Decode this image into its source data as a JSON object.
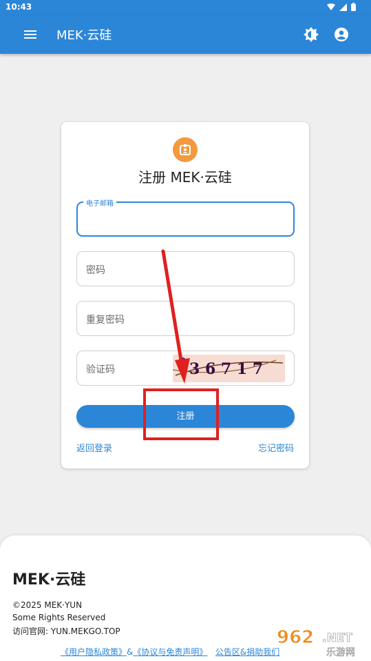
{
  "status_bar": {
    "time": "10:43"
  },
  "app_bar": {
    "title": "MEK·云硅"
  },
  "card": {
    "heading": "注册 MEK·云硅",
    "email_label": "电子邮箱",
    "password_placeholder": "密码",
    "repeat_password_placeholder": "重复密码",
    "captcha_placeholder": "验证码",
    "captcha_text": "3 6 7 1 7",
    "submit_label": "注册",
    "back_login": "返回登录",
    "forgot_password": "忘记密码"
  },
  "footer": {
    "brand": "MEK·云硅",
    "copyright": "©2025 MEK·YUN",
    "rights": "Some Rights Reserved",
    "site": "访问官网: YUN.MEKGO.TOP",
    "privacy_link": "《用户隐私政策》",
    "ampersand": "&",
    "agreement_link": "《协议与免责声明》",
    "announce_link": "公告区&捐助我们"
  },
  "watermark": {
    "text_962": "962",
    "text_net": ".NET",
    "text_cn": "乐游网"
  },
  "colors": {
    "primary": "#2b86d8",
    "badge": "#f3993e",
    "annotation": "#e02020"
  },
  "icons": [
    "menu-icon",
    "brightness-icon",
    "account-icon",
    "badge-icon",
    "wifi-icon",
    "signal-icon",
    "battery-icon"
  ]
}
